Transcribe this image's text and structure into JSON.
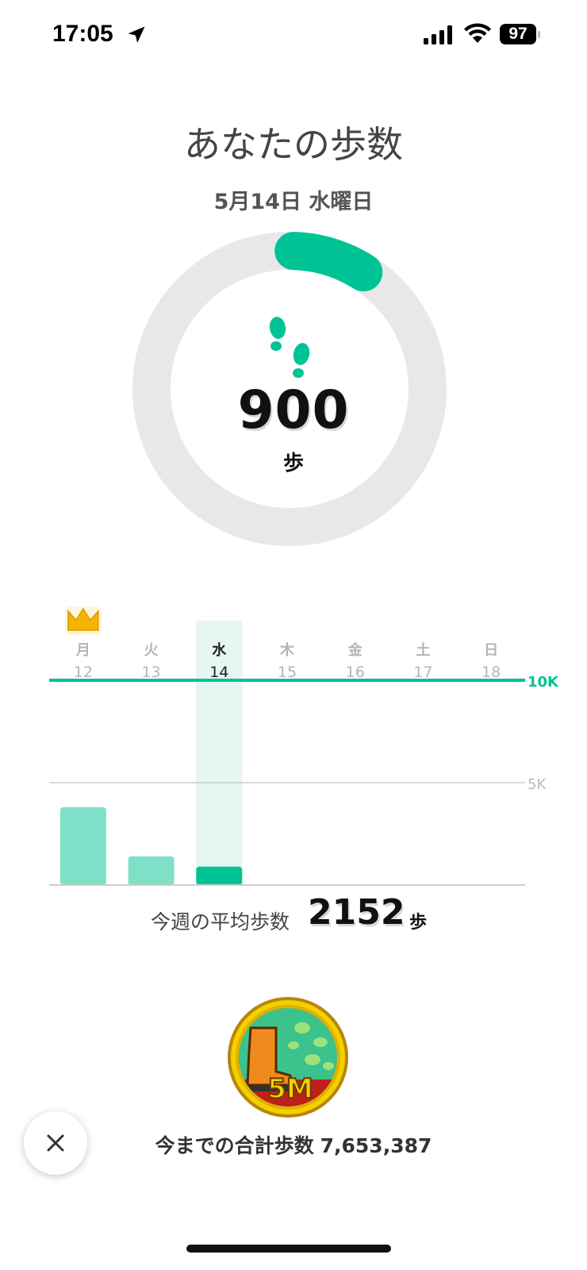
{
  "status_bar": {
    "time": "17:05",
    "battery": "97",
    "icons": [
      "location-arrow-icon",
      "cellular-signal-icon",
      "wifi-icon",
      "battery-icon"
    ]
  },
  "header": {
    "title": "あなたの歩数",
    "date": "5月14日 水曜日"
  },
  "today": {
    "steps": "900",
    "unit": "歩",
    "goal_progress": 0.09,
    "icon": "footprints-icon"
  },
  "colors": {
    "accent": "#00C395",
    "bar_light": "#7FE0C8",
    "ring_track": "#E8E8E8",
    "highlight": "#E6F6F2"
  },
  "chart_data": {
    "type": "bar",
    "categories": [
      {
        "day": "月",
        "date": "12"
      },
      {
        "day": "火",
        "date": "13"
      },
      {
        "day": "水",
        "date": "14"
      },
      {
        "day": "木",
        "date": "15"
      },
      {
        "day": "金",
        "date": "16"
      },
      {
        "day": "土",
        "date": "17"
      },
      {
        "day": "日",
        "date": "18"
      }
    ],
    "values": [
      3800,
      1400,
      900,
      null,
      null,
      null,
      null
    ],
    "selected_index": 2,
    "best_day_index": 0,
    "best_day_icon": "crown-icon",
    "goal_line": {
      "value": 10000,
      "label": "10K"
    },
    "reference_line": {
      "value": 5000,
      "label": "5K"
    },
    "ylim": [
      0,
      10000
    ]
  },
  "weekly_average": {
    "label": "今週の平均歩数",
    "value": "2152",
    "unit": "歩"
  },
  "total": {
    "label": "今までの合計歩数",
    "value": "7,653,387",
    "medal_label": "5M",
    "medal_icon": "medal-5m-badge-icon"
  },
  "close_button": {
    "icon": "close-icon"
  }
}
